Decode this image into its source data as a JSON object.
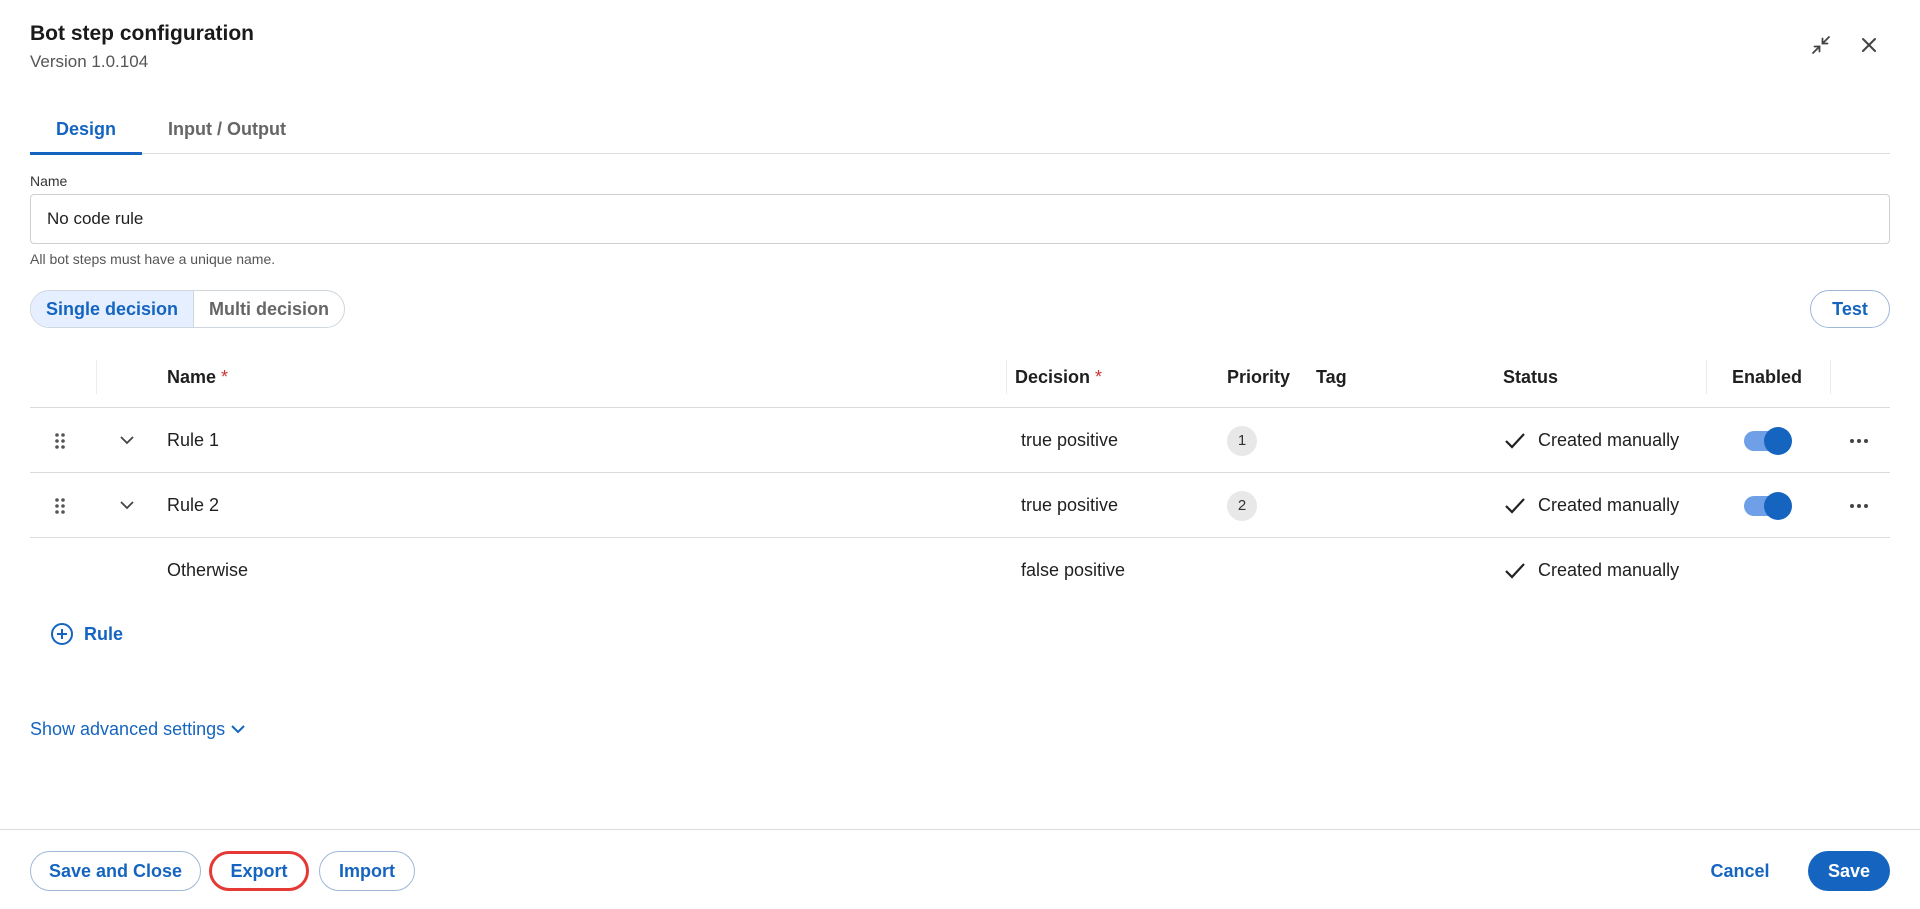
{
  "dialog": {
    "title": "Bot step configuration",
    "version": "Version 1.0.104"
  },
  "window_icons": [
    "collapse-icon",
    "close-icon"
  ],
  "tabs": [
    {
      "label": "Design",
      "active": true
    },
    {
      "label": "Input / Output",
      "active": false
    }
  ],
  "name_field": {
    "label": "Name",
    "value": "No code rule",
    "helper": "All bot steps must have a unique name."
  },
  "decision_mode": {
    "options": [
      "Single decision",
      "Multi decision"
    ],
    "selected": "Single decision"
  },
  "test_label": "Test",
  "table": {
    "columns": {
      "name": "Name",
      "decision": "Decision",
      "priority": "Priority",
      "tag": "Tag",
      "status": "Status",
      "enabled": "Enabled"
    },
    "required_mark": "*",
    "rows": [
      {
        "name": "Rule 1",
        "decision": "true positive",
        "priority": "1",
        "tag": "",
        "status": "Created manually",
        "enabled": true
      },
      {
        "name": "Rule 2",
        "decision": "true positive",
        "priority": "2",
        "tag": "",
        "status": "Created manually",
        "enabled": true
      }
    ],
    "otherwise": {
      "name": "Otherwise",
      "decision": "false positive",
      "status": "Created manually"
    }
  },
  "add_rule_label": "Rule",
  "advanced_label": "Show advanced settings",
  "footer": {
    "save_close": "Save and Close",
    "export": "Export",
    "import": "Import",
    "cancel": "Cancel",
    "save": "Save"
  },
  "colors": {
    "accent": "#1565c0",
    "highlight": "#e53935",
    "required": "#d32f2f"
  }
}
